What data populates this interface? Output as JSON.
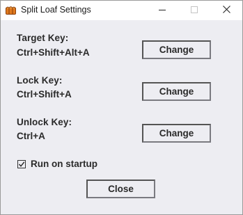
{
  "window": {
    "title": "Split Loaf Settings",
    "app_icon": "bread-loaf-icon"
  },
  "titlebar_controls": {
    "minimize_icon": "minimize-icon",
    "maximize_icon": "maximize-icon",
    "close_icon": "close-icon"
  },
  "settings": {
    "target": {
      "label": "Target Key:",
      "value": "Ctrl+Shift+Alt+A",
      "button": "Change"
    },
    "lock": {
      "label": "Lock Key:",
      "value": "Ctrl+Shift+A",
      "button": "Change"
    },
    "unlock": {
      "label": "Unlock Key:",
      "value": "Ctrl+A",
      "button": "Change"
    }
  },
  "run_on_startup": {
    "label": "Run on startup",
    "checked": true
  },
  "footer": {
    "close_label": "Close"
  },
  "colors": {
    "window_bg": "#ededf2",
    "titlebar_bg": "#ffffff",
    "button_shadow": "#7a7a80"
  }
}
